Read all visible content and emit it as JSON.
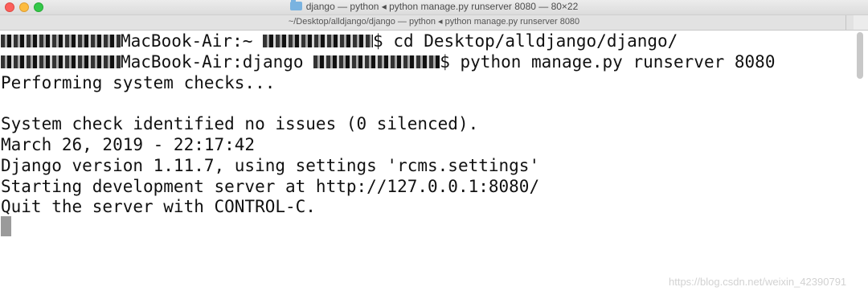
{
  "window": {
    "title": "django — python ◂ python manage.py runserver 8080 — 80×22",
    "tab_title": "~/Desktop/alldjango/django — python ◂ python manage.py runserver 8080"
  },
  "terminal": {
    "lines": [
      {
        "host": "MacBook-Air:~",
        "prompt": "$ cd Desktop/alldjango/django/"
      },
      {
        "host": "MacBook-Air:django",
        "prompt": "$ python manage.py runserver 8080"
      },
      {
        "text": "Performing system checks..."
      },
      {
        "text": ""
      },
      {
        "text": "System check identified no issues (0 silenced)."
      },
      {
        "text": "March 26, 2019 - 22:17:42"
      },
      {
        "text": "Django version 1.11.7, using settings 'rcms.settings'"
      },
      {
        "text": "Starting development server at http://127.0.0.1:8080/"
      },
      {
        "text": "Quit the server with CONTROL-C."
      }
    ]
  },
  "watermark": "https://blog.csdn.net/weixin_42390791"
}
